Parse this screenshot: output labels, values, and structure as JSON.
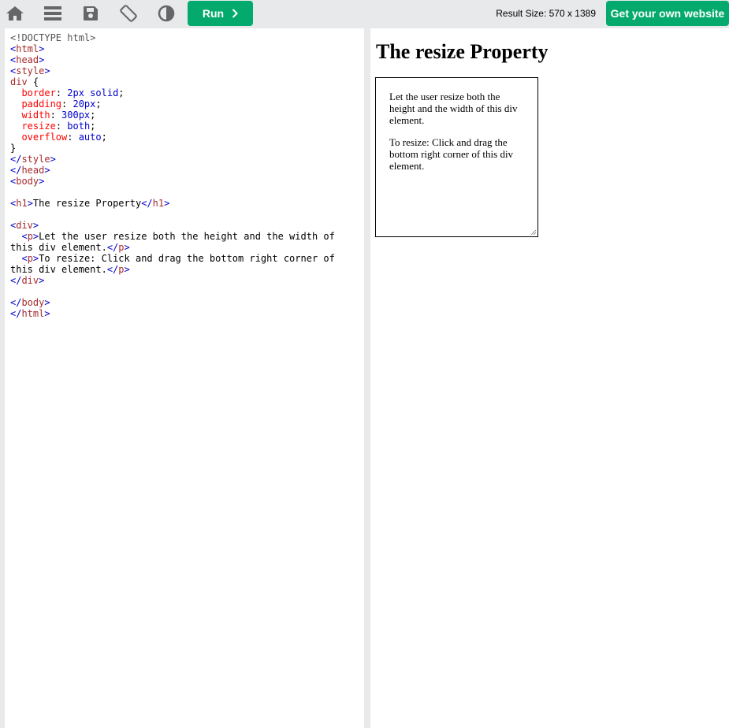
{
  "toolbar": {
    "icons": [
      "home-icon",
      "menu-icon",
      "save-icon",
      "rotate-icon",
      "contrast-icon"
    ],
    "run_label": "Run",
    "result_size": "Result Size: 570 x 1389",
    "get_website_label": "Get your own website"
  },
  "editor": {
    "lines": [
      "<!DOCTYPE html>",
      "<html>",
      "<head>",
      "<style>",
      "div {",
      "  border: 2px solid;",
      "  padding: 20px;",
      "  width: 300px;",
      "  resize: both;",
      "  overflow: auto;",
      "}",
      "</style>",
      "</head>",
      "<body>",
      "",
      "<h1>The resize Property</h1>",
      "",
      "<div>",
      "  <p>Let the user resize both the height and the width of",
      "this div element.</p>",
      "  <p>To resize: Click and drag the bottom right corner of",
      "this div element.</p>",
      "</div>",
      "",
      "</body>",
      "</html>"
    ]
  },
  "result": {
    "heading": "The resize Property",
    "paragraph_1": "Let the user resize both the height and the width of this div element.",
    "paragraph_2": "To resize: Click and drag the bottom right corner of this div element."
  },
  "colors": {
    "accent": "#04aa6d",
    "toolbar_bg": "#e7e9eb",
    "icon": "#555555"
  }
}
